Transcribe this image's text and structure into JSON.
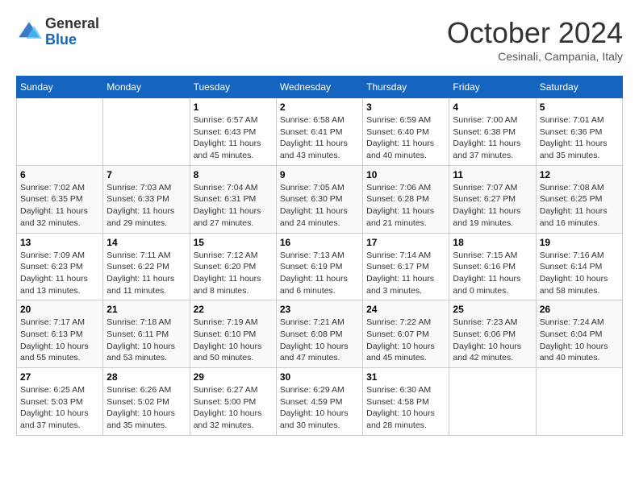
{
  "header": {
    "logo_line1": "General",
    "logo_line2": "Blue",
    "month": "October 2024",
    "location": "Cesinali, Campania, Italy"
  },
  "weekdays": [
    "Sunday",
    "Monday",
    "Tuesday",
    "Wednesday",
    "Thursday",
    "Friday",
    "Saturday"
  ],
  "weeks": [
    [
      {
        "day": "",
        "sunrise": "",
        "sunset": "",
        "daylight": ""
      },
      {
        "day": "",
        "sunrise": "",
        "sunset": "",
        "daylight": ""
      },
      {
        "day": "1",
        "sunrise": "Sunrise: 6:57 AM",
        "sunset": "Sunset: 6:43 PM",
        "daylight": "Daylight: 11 hours and 45 minutes."
      },
      {
        "day": "2",
        "sunrise": "Sunrise: 6:58 AM",
        "sunset": "Sunset: 6:41 PM",
        "daylight": "Daylight: 11 hours and 43 minutes."
      },
      {
        "day": "3",
        "sunrise": "Sunrise: 6:59 AM",
        "sunset": "Sunset: 6:40 PM",
        "daylight": "Daylight: 11 hours and 40 minutes."
      },
      {
        "day": "4",
        "sunrise": "Sunrise: 7:00 AM",
        "sunset": "Sunset: 6:38 PM",
        "daylight": "Daylight: 11 hours and 37 minutes."
      },
      {
        "day": "5",
        "sunrise": "Sunrise: 7:01 AM",
        "sunset": "Sunset: 6:36 PM",
        "daylight": "Daylight: 11 hours and 35 minutes."
      }
    ],
    [
      {
        "day": "6",
        "sunrise": "Sunrise: 7:02 AM",
        "sunset": "Sunset: 6:35 PM",
        "daylight": "Daylight: 11 hours and 32 minutes."
      },
      {
        "day": "7",
        "sunrise": "Sunrise: 7:03 AM",
        "sunset": "Sunset: 6:33 PM",
        "daylight": "Daylight: 11 hours and 29 minutes."
      },
      {
        "day": "8",
        "sunrise": "Sunrise: 7:04 AM",
        "sunset": "Sunset: 6:31 PM",
        "daylight": "Daylight: 11 hours and 27 minutes."
      },
      {
        "day": "9",
        "sunrise": "Sunrise: 7:05 AM",
        "sunset": "Sunset: 6:30 PM",
        "daylight": "Daylight: 11 hours and 24 minutes."
      },
      {
        "day": "10",
        "sunrise": "Sunrise: 7:06 AM",
        "sunset": "Sunset: 6:28 PM",
        "daylight": "Daylight: 11 hours and 21 minutes."
      },
      {
        "day": "11",
        "sunrise": "Sunrise: 7:07 AM",
        "sunset": "Sunset: 6:27 PM",
        "daylight": "Daylight: 11 hours and 19 minutes."
      },
      {
        "day": "12",
        "sunrise": "Sunrise: 7:08 AM",
        "sunset": "Sunset: 6:25 PM",
        "daylight": "Daylight: 11 hours and 16 minutes."
      }
    ],
    [
      {
        "day": "13",
        "sunrise": "Sunrise: 7:09 AM",
        "sunset": "Sunset: 6:23 PM",
        "daylight": "Daylight: 11 hours and 13 minutes."
      },
      {
        "day": "14",
        "sunrise": "Sunrise: 7:11 AM",
        "sunset": "Sunset: 6:22 PM",
        "daylight": "Daylight: 11 hours and 11 minutes."
      },
      {
        "day": "15",
        "sunrise": "Sunrise: 7:12 AM",
        "sunset": "Sunset: 6:20 PM",
        "daylight": "Daylight: 11 hours and 8 minutes."
      },
      {
        "day": "16",
        "sunrise": "Sunrise: 7:13 AM",
        "sunset": "Sunset: 6:19 PM",
        "daylight": "Daylight: 11 hours and 6 minutes."
      },
      {
        "day": "17",
        "sunrise": "Sunrise: 7:14 AM",
        "sunset": "Sunset: 6:17 PM",
        "daylight": "Daylight: 11 hours and 3 minutes."
      },
      {
        "day": "18",
        "sunrise": "Sunrise: 7:15 AM",
        "sunset": "Sunset: 6:16 PM",
        "daylight": "Daylight: 11 hours and 0 minutes."
      },
      {
        "day": "19",
        "sunrise": "Sunrise: 7:16 AM",
        "sunset": "Sunset: 6:14 PM",
        "daylight": "Daylight: 10 hours and 58 minutes."
      }
    ],
    [
      {
        "day": "20",
        "sunrise": "Sunrise: 7:17 AM",
        "sunset": "Sunset: 6:13 PM",
        "daylight": "Daylight: 10 hours and 55 minutes."
      },
      {
        "day": "21",
        "sunrise": "Sunrise: 7:18 AM",
        "sunset": "Sunset: 6:11 PM",
        "daylight": "Daylight: 10 hours and 53 minutes."
      },
      {
        "day": "22",
        "sunrise": "Sunrise: 7:19 AM",
        "sunset": "Sunset: 6:10 PM",
        "daylight": "Daylight: 10 hours and 50 minutes."
      },
      {
        "day": "23",
        "sunrise": "Sunrise: 7:21 AM",
        "sunset": "Sunset: 6:08 PM",
        "daylight": "Daylight: 10 hours and 47 minutes."
      },
      {
        "day": "24",
        "sunrise": "Sunrise: 7:22 AM",
        "sunset": "Sunset: 6:07 PM",
        "daylight": "Daylight: 10 hours and 45 minutes."
      },
      {
        "day": "25",
        "sunrise": "Sunrise: 7:23 AM",
        "sunset": "Sunset: 6:06 PM",
        "daylight": "Daylight: 10 hours and 42 minutes."
      },
      {
        "day": "26",
        "sunrise": "Sunrise: 7:24 AM",
        "sunset": "Sunset: 6:04 PM",
        "daylight": "Daylight: 10 hours and 40 minutes."
      }
    ],
    [
      {
        "day": "27",
        "sunrise": "Sunrise: 6:25 AM",
        "sunset": "Sunset: 5:03 PM",
        "daylight": "Daylight: 10 hours and 37 minutes."
      },
      {
        "day": "28",
        "sunrise": "Sunrise: 6:26 AM",
        "sunset": "Sunset: 5:02 PM",
        "daylight": "Daylight: 10 hours and 35 minutes."
      },
      {
        "day": "29",
        "sunrise": "Sunrise: 6:27 AM",
        "sunset": "Sunset: 5:00 PM",
        "daylight": "Daylight: 10 hours and 32 minutes."
      },
      {
        "day": "30",
        "sunrise": "Sunrise: 6:29 AM",
        "sunset": "Sunset: 4:59 PM",
        "daylight": "Daylight: 10 hours and 30 minutes."
      },
      {
        "day": "31",
        "sunrise": "Sunrise: 6:30 AM",
        "sunset": "Sunset: 4:58 PM",
        "daylight": "Daylight: 10 hours and 28 minutes."
      },
      {
        "day": "",
        "sunrise": "",
        "sunset": "",
        "daylight": ""
      },
      {
        "day": "",
        "sunrise": "",
        "sunset": "",
        "daylight": ""
      }
    ]
  ]
}
